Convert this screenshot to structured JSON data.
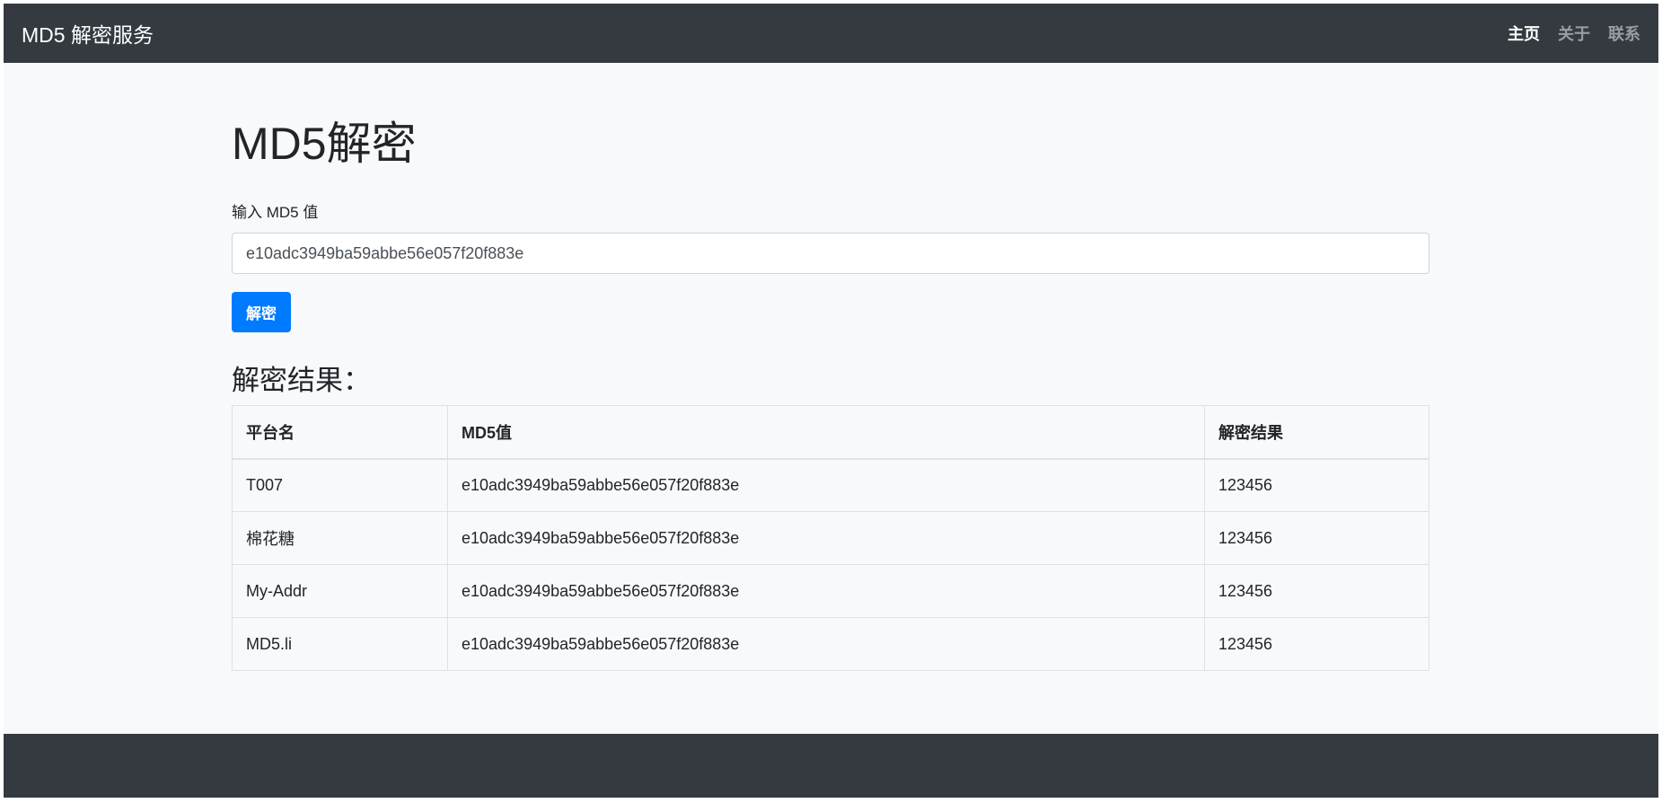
{
  "navbar": {
    "brand": "MD5 解密服务",
    "links": [
      {
        "label": "主页",
        "active": true
      },
      {
        "label": "关于",
        "active": false
      },
      {
        "label": "联系",
        "active": false
      }
    ]
  },
  "main": {
    "title": "MD5解密",
    "input_label": "输入 MD5 值",
    "input_value": "e10adc3949ba59abbe56e057f20f883e",
    "button_label": "解密",
    "result_heading": "解密结果：",
    "table": {
      "headers": [
        "平台名",
        "MD5值",
        "解密结果"
      ],
      "rows": [
        [
          "T007",
          "e10adc3949ba59abbe56e057f20f883e",
          "123456"
        ],
        [
          "棉花糖",
          "e10adc3949ba59abbe56e057f20f883e",
          "123456"
        ],
        [
          "My-Addr",
          "e10adc3949ba59abbe56e057f20f883e",
          "123456"
        ],
        [
          "MD5.li",
          "e10adc3949ba59abbe56e057f20f883e",
          "123456"
        ]
      ]
    }
  },
  "colors": {
    "navbar_bg": "#343a40",
    "page_bg": "#f8f9fa",
    "primary": "#007bff"
  }
}
